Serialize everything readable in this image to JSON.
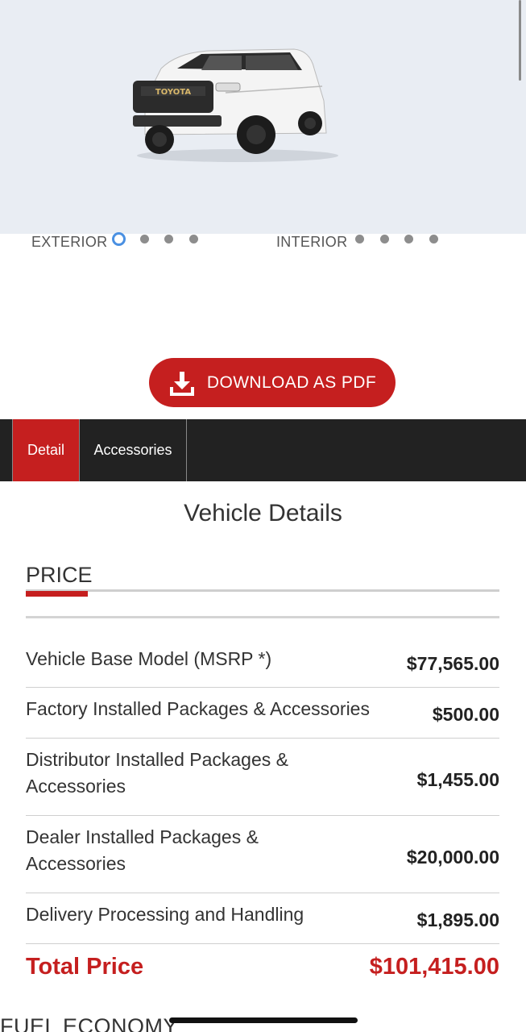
{
  "gallery": {
    "exterior_label": "EXTERIOR",
    "interior_label": "INTERIOR",
    "exterior_dots": 4,
    "interior_dots": 4,
    "active_dot": 0,
    "car_badge": "TOYOTA"
  },
  "download_button": {
    "label": "DOWNLOAD AS PDF",
    "icon": "download-icon"
  },
  "tabs": [
    {
      "label": "Detail",
      "active": true
    },
    {
      "label": "Accessories",
      "active": false
    }
  ],
  "page_title": "Vehicle Details",
  "price_section": {
    "heading": "PRICE",
    "rows": [
      {
        "label": "Vehicle Base Model (MSRP *)",
        "value": "$77,565.00"
      },
      {
        "label": "Factory Installed Packages & Accessories",
        "value": "$500.00"
      },
      {
        "label": "Distributor Installed Packages & Accessories",
        "value": "$1,455.00"
      },
      {
        "label": "Dealer Installed Packages & Accessories",
        "value": "$20,000.00"
      },
      {
        "label": "Delivery Processing and Handling",
        "value": "$1,895.00"
      }
    ],
    "total_label": "Total Price",
    "total_value": "$101,415.00"
  },
  "next_section_heading": "FUEL ECONOMY",
  "colors": {
    "accent": "#c51f1f",
    "tabbar": "#222222",
    "hero_bg": "#e9edf3",
    "active_dot": "#4a90e2"
  }
}
